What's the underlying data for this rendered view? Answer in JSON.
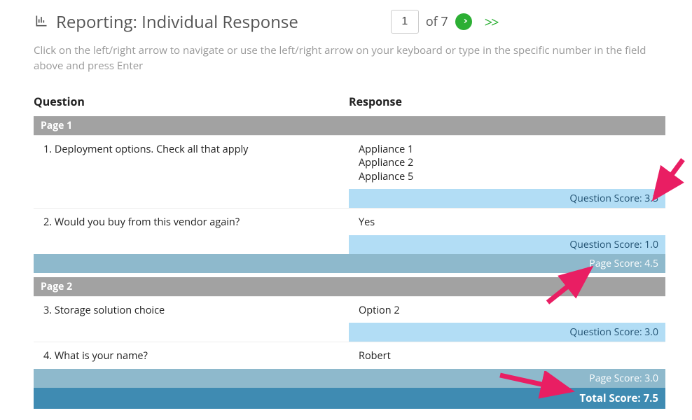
{
  "header": {
    "title": "Reporting: Individual Response",
    "current_page": "1",
    "of_label": "of 7",
    "fast_forward": ">>"
  },
  "hint": "Click on the left/right arrow to navigate or use the left/right arrow on your keyboard or type in the specific number in the field above and press Enter",
  "columns": {
    "question": "Question",
    "response": "Response"
  },
  "page1": {
    "label": "Page 1",
    "q1": {
      "text": "1. Deployment options.  Check all that apply",
      "r1": "Appliance 1",
      "r2": "Appliance 2",
      "r3": "Appliance 5",
      "score": "Question Score: 3.5"
    },
    "q2": {
      "text": "2. Would you buy from this vendor again?",
      "r1": "Yes",
      "score": "Question Score: 1.0"
    },
    "page_score": "Page Score: 4.5"
  },
  "page2": {
    "label": "Page 2",
    "q3": {
      "text": "3. Storage solution choice",
      "r1": "Option 2",
      "score": "Question Score: 3.0"
    },
    "q4": {
      "text": "4. What is your name?",
      "r1": "Robert"
    },
    "page_score": "Page Score: 3.0"
  },
  "total_score": "Total Score: 7.5"
}
